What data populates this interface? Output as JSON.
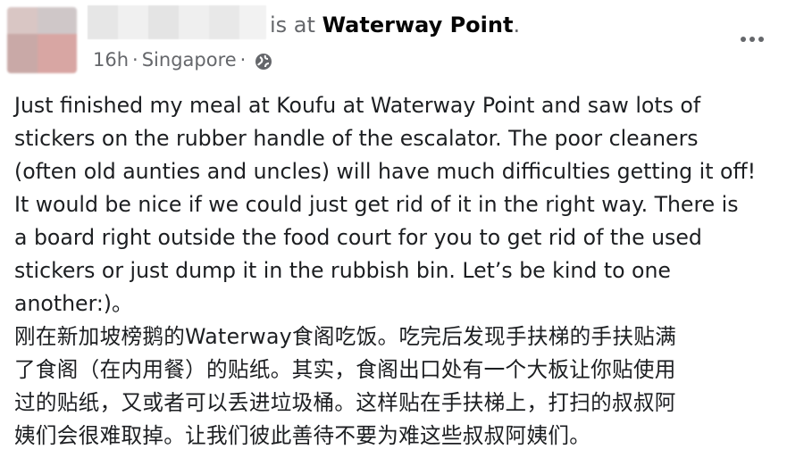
{
  "post": {
    "header": {
      "is_at": "is at",
      "place": "Waterway Point",
      "period": "."
    },
    "meta": {
      "time": "16h",
      "separator": "·",
      "location": "Singapore",
      "separator2": "·",
      "privacy_icon": "globe-icon"
    },
    "menu_icon": "more-options-icon",
    "body_lines": [
      "Just finished my meal at Koufu at Waterway Point and saw lots of",
      "stickers on the rubber handle of the escalator.  The poor cleaners",
      "(often old aunties and uncles) will have much difficulties getting it off!",
      "It would be nice if we could just get rid of it in the right way.  There is",
      "a board right outside the food court for you to get rid of the used",
      "stickers or just dump it in the rubbish bin.  Let’s be kind to one",
      "another:)。",
      "刚在新加坡榜鹅的Waterway食阁吃饭。吃完后发现手扶梯的手扶贴满",
      "了食阁（在内用餐）的贴纸。其实，食阁出口处有一个大板让你贴使用",
      "过的贴纸，又或者可以丢进垃圾桶。这样贴在手扶梯上，打扫的叔叔阿",
      "姨们会很难取掉。让我们彼此善待不要为难这些叔叔阿姨们。"
    ]
  }
}
